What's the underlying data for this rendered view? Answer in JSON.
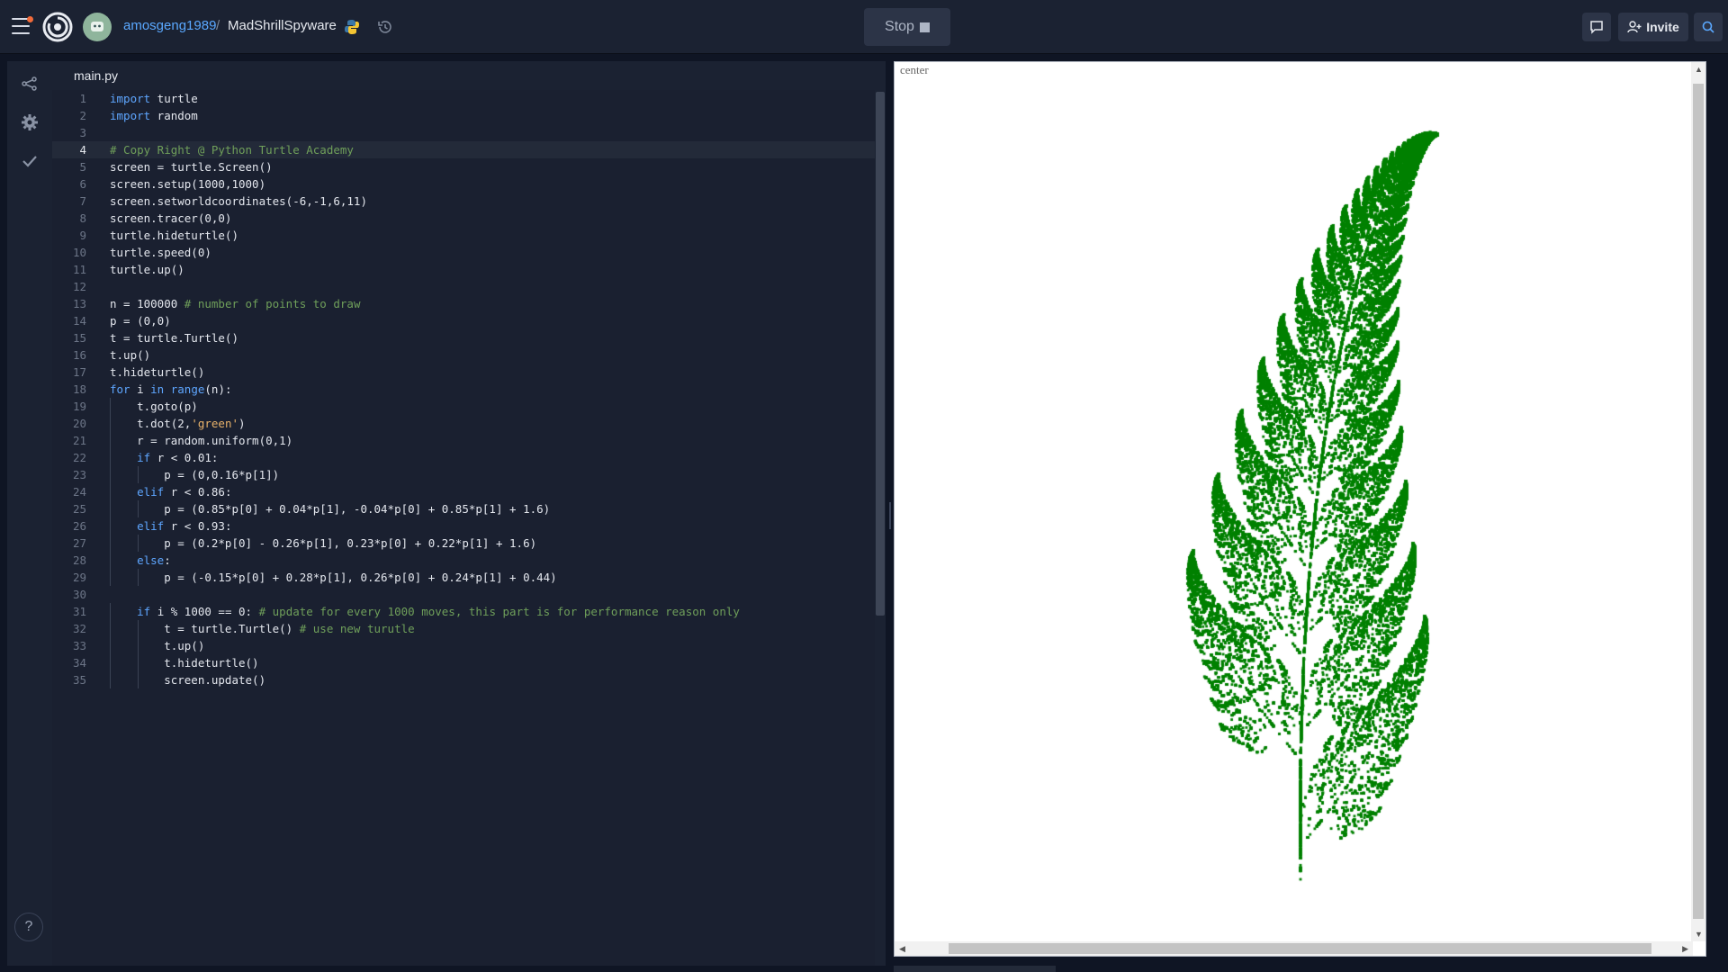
{
  "topbar": {
    "owner": "amosgeng1989",
    "separator": "/",
    "repl_name": "MadShrillSpyware",
    "stop_label": "Stop",
    "invite_label": "Invite",
    "icons": [
      "hamburger-menu-icon",
      "replit-logo-icon",
      "avatar",
      "python-icon",
      "history-icon",
      "chat-icon",
      "add-user-icon",
      "search-icon"
    ],
    "colors": {
      "link": "#5aa8ff",
      "notification": "#f26b3a",
      "bar": "#1b2232"
    }
  },
  "left_rail": {
    "icons": [
      "share-icon",
      "gear-icon",
      "check-icon"
    ],
    "help_label": "?"
  },
  "editor": {
    "tab_label": "main.py",
    "active_line": 4,
    "lines": [
      "import turtle",
      "import random",
      "",
      "# Copy Right @ Python Turtle Academy",
      "screen = turtle.Screen()",
      "screen.setup(1000,1000)",
      "screen.setworldcoordinates(-6,-1,6,11)",
      "screen.tracer(0,0)",
      "turtle.hideturtle()",
      "turtle.speed(0)",
      "turtle.up()",
      "",
      "n = 100000 # number of points to draw",
      "p = (0,0)",
      "t = turtle.Turtle()",
      "t.up()",
      "t.hideturtle()",
      "for i in range(n):",
      "    t.goto(p)",
      "    t.dot(2,'green')",
      "    r = random.uniform(0,1)",
      "    if r < 0.01:",
      "        p = (0,0.16*p[1])",
      "    elif r < 0.86:",
      "        p = (0.85*p[0] + 0.04*p[1], -0.04*p[0] + 0.85*p[1] + 1.6)",
      "    elif r < 0.93:",
      "        p = (0.2*p[0] - 0.26*p[1], 0.23*p[0] + 0.22*p[1] + 1.6)",
      "    else:",
      "        p = (-0.15*p[0] + 0.28*p[1], 0.26*p[0] + 0.24*p[1] + 0.44)",
      "",
      "    if i % 1000 == 0: # update for every 1000 moves, this part is for performance reason only",
      "        t = turtle.Turtle() # use new turutle",
      "        t.up()",
      "        t.hideturtle()",
      "        screen.update()"
    ]
  },
  "output": {
    "canvas_label": "center",
    "fern_color": "#008000",
    "world": {
      "xmin": -6,
      "ymin": -1,
      "xmax": 6,
      "ymax": 11
    }
  }
}
